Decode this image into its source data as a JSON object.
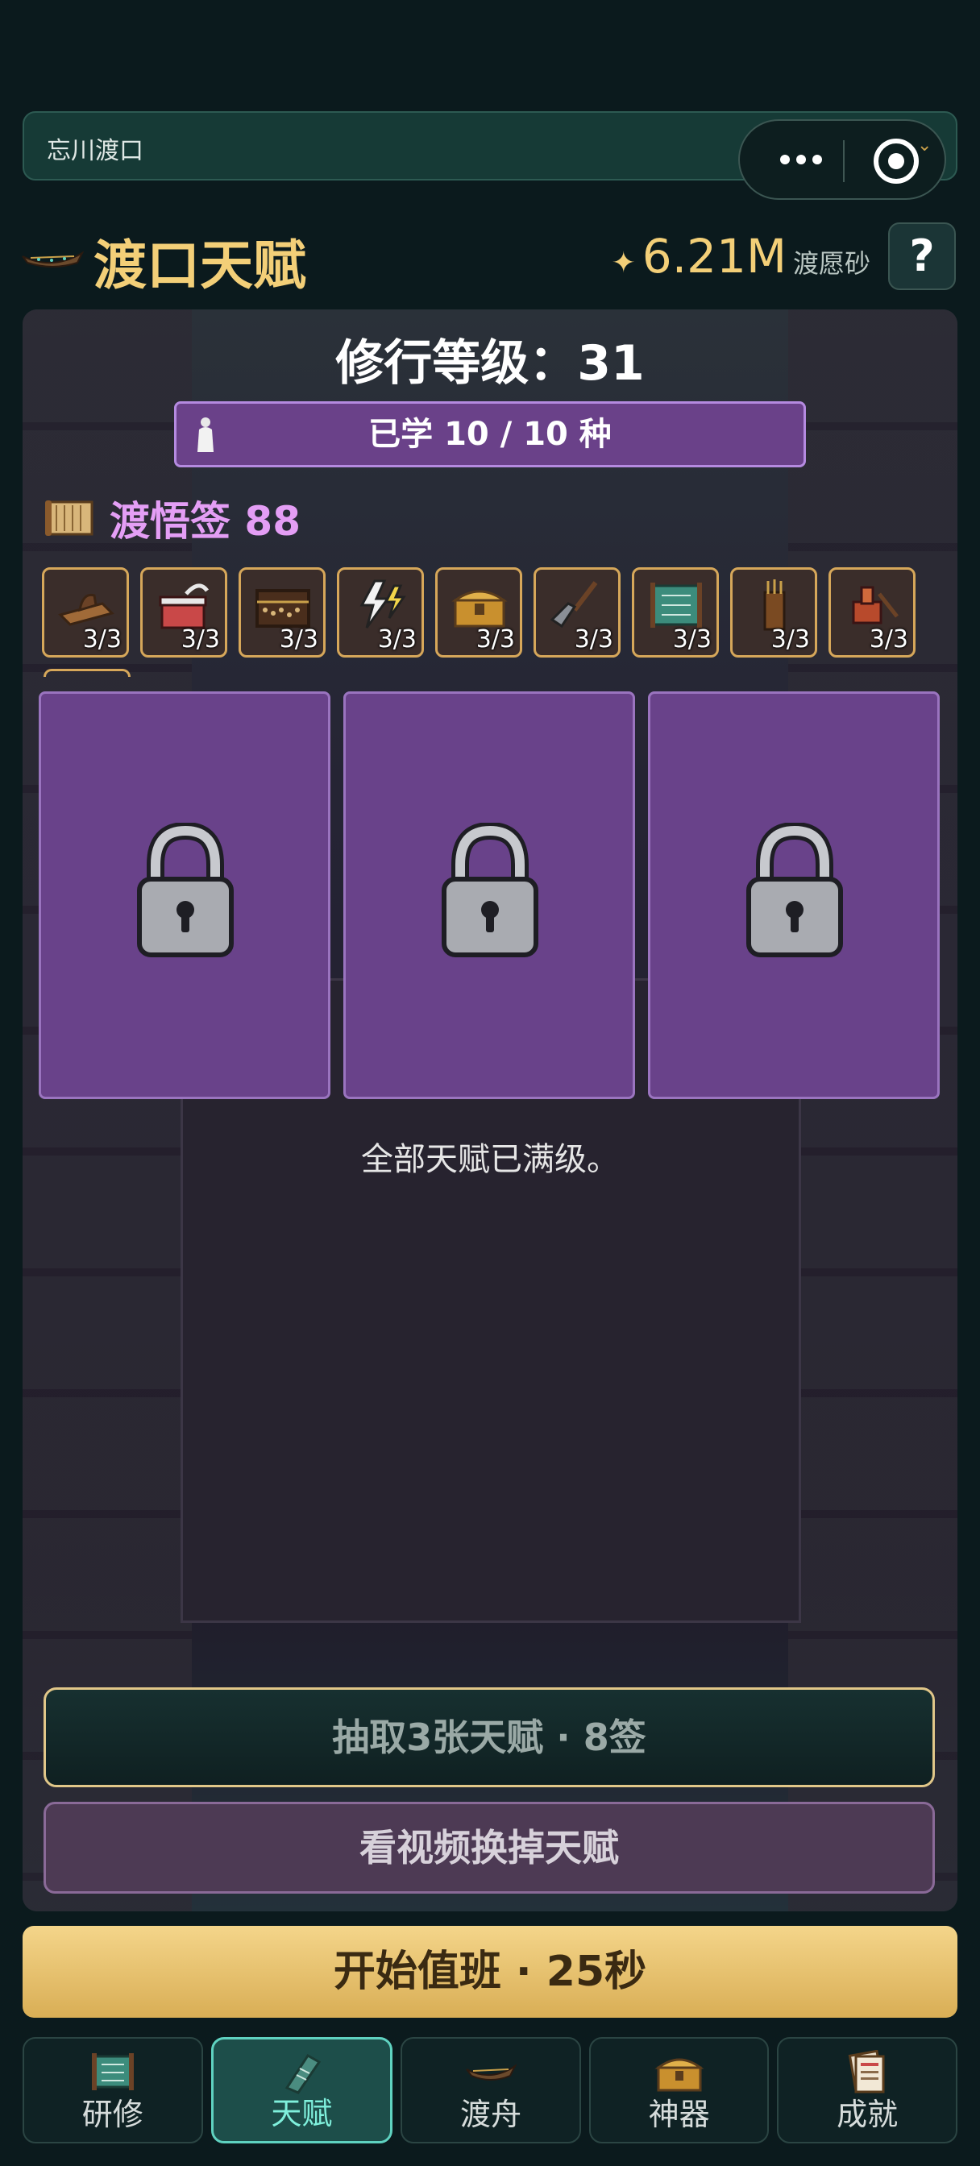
{
  "window": {
    "title": "忘川渡口"
  },
  "header": {
    "title": "渡口天赋",
    "currency_amount": "6.21M",
    "currency_unit": "渡愿砂",
    "help_label": "?"
  },
  "panel": {
    "level_text": "修行等级：31",
    "learned_text": "已学 10 / 10 种",
    "tickets_text": "渡悟签 88",
    "items": [
      {
        "icon": "woodworking-plane-icon",
        "count": "3/3"
      },
      {
        "icon": "gift-box-icon",
        "count": "3/3"
      },
      {
        "icon": "abacus-icon",
        "count": "3/3"
      },
      {
        "icon": "lightning-icon",
        "count": "3/3"
      },
      {
        "icon": "treasure-chest-icon",
        "count": "3/3"
      },
      {
        "icon": "shovel-icon",
        "count": "3/3"
      },
      {
        "icon": "scroll-map-icon",
        "count": "3/3"
      },
      {
        "icon": "quiver-icon",
        "count": "3/3"
      },
      {
        "icon": "stamp-icon",
        "count": "3/3"
      }
    ],
    "cards": [
      {
        "icon": "lock-icon"
      },
      {
        "icon": "lock-icon"
      },
      {
        "icon": "lock-icon"
      }
    ],
    "maxed_text": "全部天赋已满级。",
    "draw_button": "抽取3张天赋 · 8签",
    "video_button": "看视频换掉天赋"
  },
  "start_button": "开始值班 · 25秒",
  "tabs": [
    {
      "label": "研修",
      "icon": "scroll-icon",
      "active": false
    },
    {
      "label": "天赋",
      "icon": "talent-scroll-icon",
      "active": true
    },
    {
      "label": "渡舟",
      "icon": "boat-icon",
      "active": false
    },
    {
      "label": "神器",
      "icon": "treasure-chest-icon",
      "active": false
    },
    {
      "label": "成就",
      "icon": "achievement-book-icon",
      "active": false
    }
  ],
  "colors": {
    "accent_gold": "#f3cf78",
    "purple": "#69428a",
    "tab_active": "#5fd2c0"
  }
}
